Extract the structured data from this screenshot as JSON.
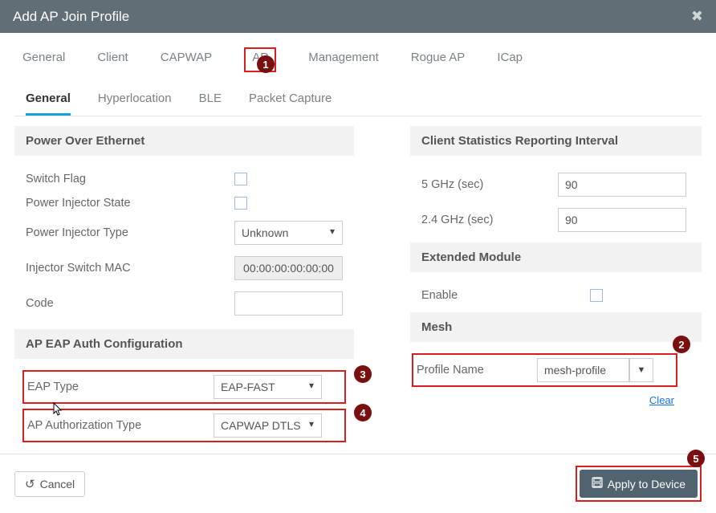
{
  "header": {
    "title": "Add AP Join Profile"
  },
  "tabs": {
    "t0": "General",
    "t1": "Client",
    "t2": "CAPWAP",
    "t3": "AP",
    "t4": "Management",
    "t5": "Rogue AP",
    "t6": "ICap"
  },
  "subtabs": {
    "s0": "General",
    "s1": "Hyperlocation",
    "s2": "BLE",
    "s3": "Packet Capture"
  },
  "poe": {
    "header": "Power Over Ethernet",
    "switch_flag": "Switch Flag",
    "pis": "Power Injector State",
    "pit_label": "Power Injector Type",
    "pit_value": "Unknown",
    "ism_label": "Injector Switch MAC",
    "ism_value": "00:00:00:00:00:00",
    "code_label": "Code",
    "code_value": ""
  },
  "eap": {
    "header": "AP EAP Auth Configuration",
    "type_label": "EAP Type",
    "type_value": "EAP-FAST",
    "auth_label": "AP Authorization Type",
    "auth_value": "CAPWAP DTLS"
  },
  "csri": {
    "header": "Client Statistics Reporting Interval",
    "ghz5_label": "5 GHz (sec)",
    "ghz5_value": "90",
    "ghz24_label": "2.4 GHz (sec)",
    "ghz24_value": "90"
  },
  "ext": {
    "header": "Extended Module",
    "enable_label": "Enable"
  },
  "mesh": {
    "header": "Mesh",
    "profname_label": "Profile Name",
    "profname_value": "mesh-profile",
    "clear": "Clear"
  },
  "footer": {
    "cancel": "Cancel",
    "apply": "Apply to Device"
  },
  "badges": {
    "b1": "1",
    "b2": "2",
    "b3": "3",
    "b4": "4",
    "b5": "5"
  }
}
